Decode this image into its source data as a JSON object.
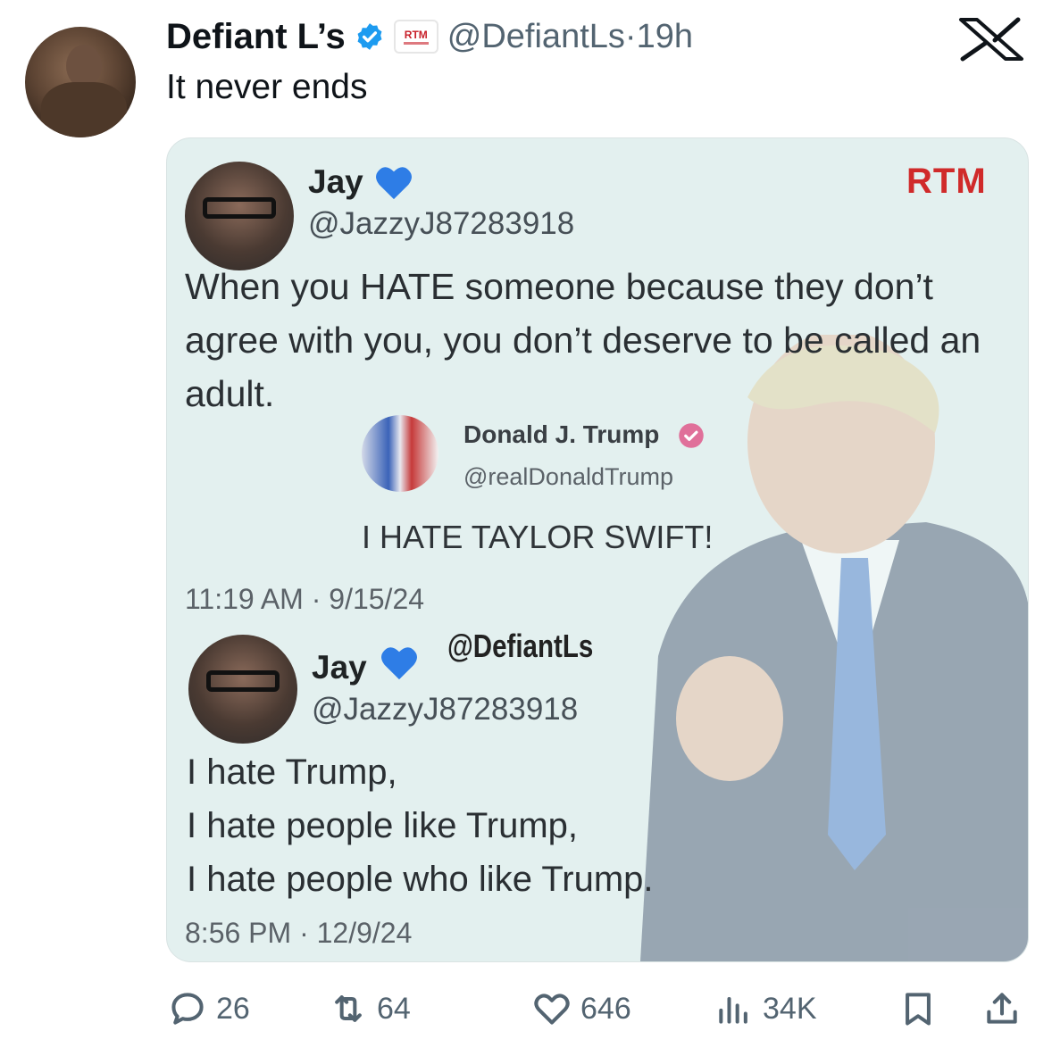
{
  "post": {
    "display_name": "Defiant L’s",
    "handle": "@DefiantLs",
    "separator": "·",
    "time": "19h",
    "affiliate_badge": "RTM",
    "text": "It never ends"
  },
  "media": {
    "rtm_label": "RTM",
    "watermark": "@DefiantLs",
    "quote1": {
      "name": "Jay",
      "handle": "@JazzyJ87283918",
      "text": "When you HATE someone because they don’t agree with you, you don’t deserve to be called an adult.",
      "timestamp": "11:19 AM · 9/15/24"
    },
    "embedded": {
      "name": "Donald J. Trump",
      "handle": "@realDonaldTrump",
      "text": "I HATE TAYLOR SWIFT!"
    },
    "quote2": {
      "name": "Jay",
      "handle": "@JazzyJ87283918",
      "lines": [
        "I hate Trump,",
        "I hate people like Trump,",
        "I hate people who like Trump."
      ],
      "timestamp": "8:56 PM · 12/9/24"
    }
  },
  "actions": {
    "replies": "26",
    "reposts": "64",
    "likes": "646",
    "views": "34K"
  },
  "icons": {
    "close": "x-logo-icon",
    "reply": "reply-icon",
    "repost": "repost-icon",
    "like": "heart-icon",
    "views": "views-icon",
    "bookmark": "bookmark-icon",
    "share": "share-icon"
  },
  "colors": {
    "verified_blue": "#1d9bf0",
    "rtm_red": "#d02a2a",
    "muted_text": "#536471",
    "media_bg": "#e3f0ef"
  }
}
